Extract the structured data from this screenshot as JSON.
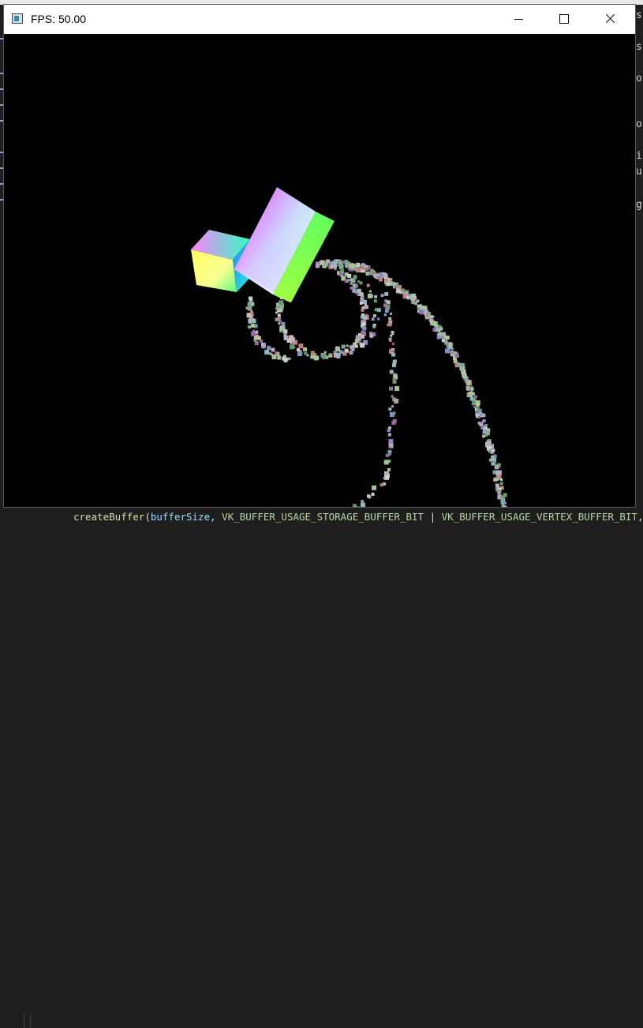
{
  "window": {
    "title": "FPS: 50.00",
    "icon": "app-window-icon"
  },
  "controls": {
    "minimize": "minimize-icon",
    "maximize": "maximize-icon",
    "close": "close-icon"
  },
  "scene": {
    "description_icons": [
      "rainbow-cube",
      "particle-trail"
    ]
  },
  "background_editor": {
    "code_tokens": [
      {
        "text": "createBuffer",
        "kind": "fn"
      },
      {
        "text": "(",
        "kind": "plain"
      },
      {
        "text": "bufferSize",
        "kind": "var"
      },
      {
        "text": ", ",
        "kind": "plain"
      },
      {
        "text": "VK_BUFFER_USAGE_STORAGE_BUFFER_BIT",
        "kind": "const"
      },
      {
        "text": " | ",
        "kind": "plain"
      },
      {
        "text": "VK_BUFFER_USAGE_VERTEX_BUFFER_BIT",
        "kind": "const"
      },
      {
        "text": ",",
        "kind": "plain"
      }
    ],
    "right_edge_fragments": [
      "s\\",
      "s\\",
      "op",
      "on",
      "ic",
      "ul",
      "g."
    ]
  }
}
